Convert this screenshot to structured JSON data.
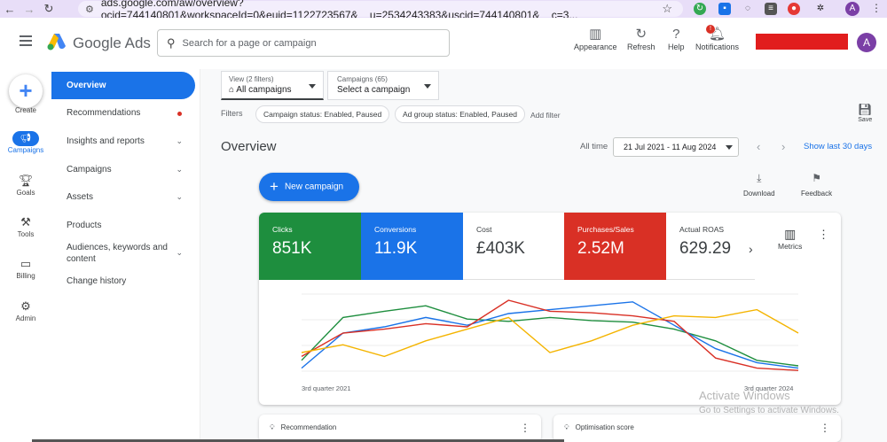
{
  "browser": {
    "url": "ads.google.com/aw/overview?ocid=744140801&workspaceId=0&euid=1122723567&__u=2534243383&uscid=744140801&__c=3...",
    "profile_initial": "A"
  },
  "header": {
    "brand": "Google Ads",
    "search_placeholder": "Search for a page or campaign",
    "tools": [
      {
        "icon": "appearance-icon",
        "label": "Appearance"
      },
      {
        "icon": "refresh-icon",
        "label": "Refresh"
      },
      {
        "icon": "help-icon",
        "label": "Help"
      },
      {
        "icon": "bell-icon",
        "label": "Notifications",
        "badge": "!"
      }
    ],
    "avatar_initial": "A"
  },
  "rail": {
    "create_label": "Create",
    "items": [
      {
        "icon": "campaigns-icon",
        "label": "Campaigns",
        "active": true
      },
      {
        "icon": "goals-icon",
        "label": "Goals"
      },
      {
        "icon": "tools-icon",
        "label": "Tools"
      },
      {
        "icon": "billing-icon",
        "label": "Billing"
      },
      {
        "icon": "admin-icon",
        "label": "Admin"
      }
    ]
  },
  "sidebar": {
    "items": [
      {
        "label": "Overview",
        "selected": true
      },
      {
        "label": "Recommendations",
        "dot": true
      },
      {
        "label": "Insights and reports",
        "expand": true
      },
      {
        "label": "Campaigns",
        "expand": true
      },
      {
        "label": "Assets",
        "expand": true
      },
      {
        "label": "Products"
      },
      {
        "label": "Audiences, keywords and content",
        "expand": true
      },
      {
        "label": "Change history"
      }
    ]
  },
  "toolbar": {
    "view_label": "View (2 filters)",
    "view_value": "All campaigns",
    "campaigns_label": "Campaigns (65)",
    "campaigns_value": "Select a campaign",
    "filters_label": "Filters",
    "chips": [
      "Campaign status: Enabled, Paused",
      "Ad group status: Enabled, Paused"
    ],
    "add_filter": "Add filter",
    "save_label": "Save"
  },
  "overview": {
    "title": "Overview",
    "all_time": "All time",
    "date_range": "21 Jul 2021 - 11 Aug 2024",
    "show_last": "Show last 30 days",
    "new_campaign": "New campaign",
    "download": "Download",
    "feedback": "Feedback"
  },
  "metrics": {
    "tiles": [
      {
        "label": "Clicks",
        "value": "851K",
        "color": "#1e8e3e"
      },
      {
        "label": "Conversions",
        "value": "11.9K",
        "color": "#1a73e8"
      },
      {
        "label": "Cost",
        "value": "£403K",
        "color": "#ffffff"
      },
      {
        "label": "Purchases/Sales",
        "value": "2.52M",
        "color": "#d93025"
      },
      {
        "label": "Actual ROAS",
        "value": "629.29",
        "color": "#ffffff"
      }
    ],
    "metrics_button": "Metrics",
    "x_start": "3rd quarter 2021",
    "x_end": "3rd quarter 2024"
  },
  "chart_data": {
    "type": "line",
    "x": [
      0,
      1,
      2,
      3,
      4,
      5,
      6,
      7,
      8,
      9,
      10,
      11,
      12
    ],
    "series": [
      {
        "color": "#1e8e3e",
        "values": [
          0.15,
          0.7,
          0.78,
          0.85,
          0.68,
          0.65,
          0.7,
          0.66,
          0.64,
          0.55,
          0.4,
          0.15,
          0.08
        ]
      },
      {
        "color": "#1a73e8",
        "values": [
          0.05,
          0.5,
          0.58,
          0.7,
          0.6,
          0.75,
          0.8,
          0.85,
          0.9,
          0.6,
          0.3,
          0.12,
          0.05
        ]
      },
      {
        "color": "#d93025",
        "values": [
          0.2,
          0.5,
          0.55,
          0.62,
          0.58,
          0.92,
          0.78,
          0.76,
          0.72,
          0.65,
          0.18,
          0.05,
          0.02
        ]
      },
      {
        "color": "#f4b400",
        "values": [
          0.25,
          0.35,
          0.2,
          0.4,
          0.55,
          0.7,
          0.25,
          0.4,
          0.6,
          0.72,
          0.7,
          0.8,
          0.5
        ]
      }
    ]
  },
  "bottom": {
    "recommendation": "Recommendation",
    "optimisation": "Optimisation score"
  },
  "watermark": {
    "line1": "Activate Windows",
    "line2": "Go to Settings to activate Windows."
  }
}
